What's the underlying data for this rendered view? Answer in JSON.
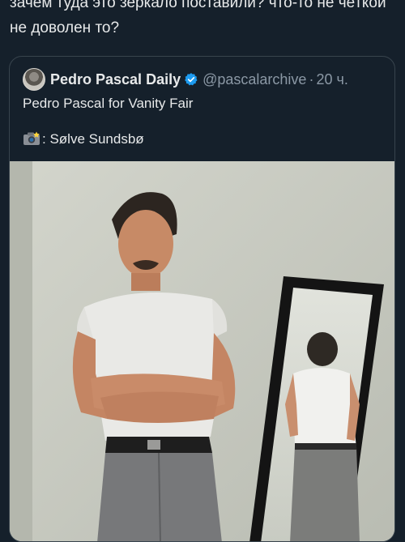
{
  "tweet": {
    "text_line1": "зачем туда это зеркало поставили? что-то не чёткой",
    "text_line2": "не доволен то?"
  },
  "quote": {
    "author_name": "Pedro Pascal Daily",
    "handle": "@pascalarchive",
    "separator": "·",
    "time": "20 ч.",
    "text_line1": "Pedro Pascal for Vanity Fair",
    "credit": ": Sølve Sundsbø",
    "icons": {
      "avatar": "avatar-image",
      "verified": "verified-badge-icon",
      "camera": "camera-flash-emoji-icon"
    },
    "colors": {
      "verified": "#1d9bf0",
      "background": "#15202b",
      "border": "#38444d",
      "secondary_text": "#8b98a5"
    }
  },
  "media": {
    "alt": "photo"
  }
}
